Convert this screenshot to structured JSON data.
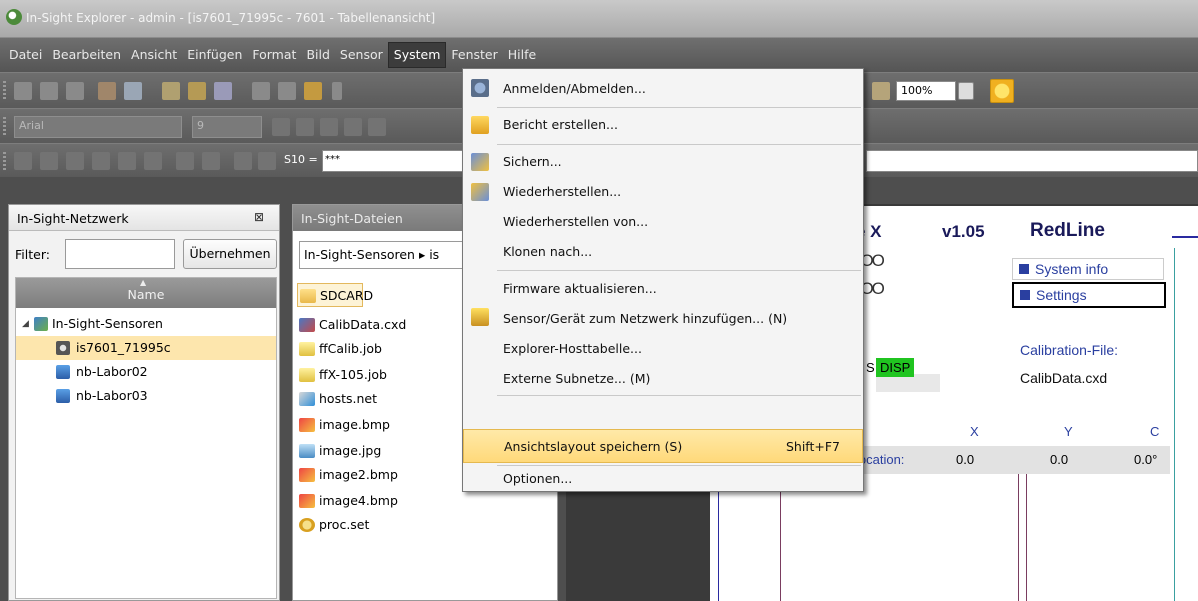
{
  "window": {
    "title": "In-Sight Explorer - admin - [is7601_71995c - 7601 - Tabellenansicht]"
  },
  "menubar": {
    "items": [
      "Datei",
      "Bearbeiten",
      "Ansicht",
      "Einfügen",
      "Format",
      "Bild",
      "Sensor",
      "System",
      "Fenster",
      "Hilfe"
    ],
    "active": "System"
  },
  "toolbar": {
    "font_name": "Arial",
    "font_size": "9",
    "cell_ref": "S10 =",
    "formula_value": "***",
    "zoom": "100%"
  },
  "network_panel": {
    "title": "In-Sight-Netzwerk",
    "filter_label": "Filter:",
    "filter_value": "",
    "apply_button": "Übernehmen",
    "column_header": "Name",
    "tree": [
      {
        "label": "In-Sight-Sensoren",
        "level": 0,
        "selected": false,
        "icon": "network-folder-icon"
      },
      {
        "label": "is7601_71995c",
        "level": 1,
        "selected": true,
        "icon": "camera-icon"
      },
      {
        "label": "nb-Labor02",
        "level": 1,
        "selected": false,
        "icon": "computer-icon"
      },
      {
        "label": "nb-Labor03",
        "level": 1,
        "selected": false,
        "icon": "computer-icon"
      }
    ]
  },
  "files_panel": {
    "title": "In-Sight-Dateien",
    "breadcrumb": "In-Sight-Sensoren ▸ is",
    "files": [
      {
        "name": "SDCARD",
        "icon": "folder-icon"
      },
      {
        "name": "CalibData.cxd",
        "icon": "calibration-file-icon"
      },
      {
        "name": "ffCalib.job",
        "icon": "job-file-icon"
      },
      {
        "name": "ffX-105.job",
        "icon": "job-file-icon"
      },
      {
        "name": "hosts.net",
        "icon": "network-file-icon"
      },
      {
        "name": "image.bmp",
        "icon": "bmp-image-icon"
      },
      {
        "name": "image.jpg",
        "icon": "jpg-image-icon"
      },
      {
        "name": "image2.bmp",
        "icon": "bmp-image-icon"
      },
      {
        "name": "image4.bmp",
        "icon": "bmp-image-icon"
      },
      {
        "name": "proc.set",
        "icon": "settings-file-icon"
      }
    ]
  },
  "spreadsheet": {
    "title_fragment": "e X",
    "version": "v1.05",
    "brand": "RedLine",
    "system_info_link": "System info",
    "settings_link": "Settings",
    "circles_row1": "OOOO",
    "circles_row2": "OOOO",
    "calibration_label": "Calibration-File:",
    "calibration_value": "CalibData.cxd",
    "status_s": "S",
    "status_disp": "DISP",
    "col_x": "X",
    "col_y": "Y",
    "col_c": "C",
    "location_label": "location:",
    "val_x": "0.0",
    "val_y": "0.0",
    "val_c": "0.0°"
  },
  "system_menu": {
    "items": [
      {
        "label": "Anmelden/Abmelden...",
        "shortcut": "",
        "icon": "login-icon"
      },
      {
        "label": "Bericht erstellen...",
        "shortcut": "",
        "icon": "report-icon"
      },
      {
        "label": "Sichern...",
        "shortcut": "",
        "icon": "backup-icon"
      },
      {
        "label": "Wiederherstellen...",
        "shortcut": "",
        "icon": "restore-icon"
      },
      {
        "label": "Wiederherstellen von...",
        "shortcut": "",
        "icon": ""
      },
      {
        "label": "Klonen nach...",
        "shortcut": "",
        "icon": ""
      },
      {
        "label": "Firmware aktualisieren...",
        "shortcut": "",
        "icon": ""
      },
      {
        "label": "Sensor/Gerät zum Netzwerk hinzufügen... (N)",
        "shortcut": "",
        "icon": "add-sensor-icon"
      },
      {
        "label": "Explorer-Hosttabelle...",
        "shortcut": "",
        "icon": ""
      },
      {
        "label": "Externe Subnetze... (M)",
        "shortcut": "",
        "icon": ""
      },
      {
        "label": "Ansichtslayout speichern (S)",
        "shortcut": "Shift+F7",
        "icon": "",
        "highlighted": true
      },
      {
        "label": "Optionen...",
        "shortcut": "",
        "icon": ""
      }
    ]
  }
}
